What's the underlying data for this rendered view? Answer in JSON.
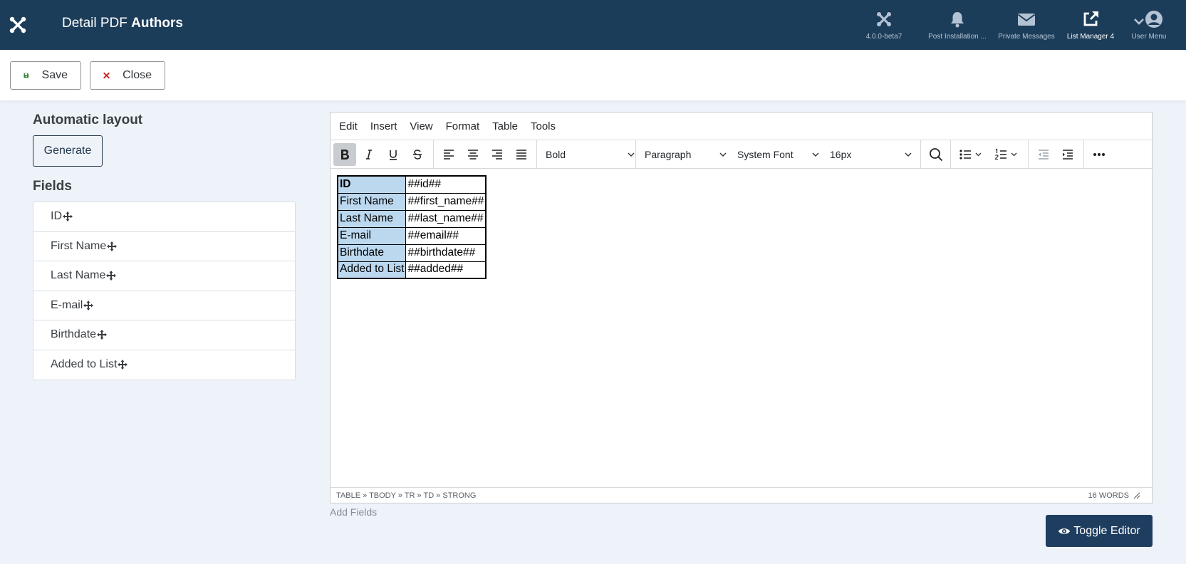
{
  "header": {
    "title_prefix": "Detail PDF",
    "title_strong": "Authors",
    "items": [
      {
        "label": "4.0.0-beta7",
        "icon": "joomla-icon"
      },
      {
        "label": "Post Installation ...",
        "icon": "bell-icon"
      },
      {
        "label": "Private Messages",
        "icon": "envelope-icon"
      },
      {
        "label": "List Manager 4",
        "icon": "external-link-icon"
      },
      {
        "label": "User Menu",
        "icon": "user-icon"
      }
    ]
  },
  "toolbar": {
    "save_label": "Save",
    "close_label": "Close"
  },
  "left": {
    "auto_layout_title": "Automatic layout",
    "generate_label": "Generate",
    "fields_title": "Fields",
    "fields": [
      "ID",
      "First Name",
      "Last Name",
      "E-mail",
      "Birthdate",
      "Added to List"
    ]
  },
  "editor": {
    "menu": [
      "Edit",
      "Insert",
      "View",
      "Format",
      "Table",
      "Tools"
    ],
    "block_format": "Bold",
    "paragraph_format": "Paragraph",
    "font_family": "System Font",
    "font_size": "16px",
    "table_rows": [
      {
        "label": "ID",
        "value": "##id##"
      },
      {
        "label": "First Name",
        "value": "##first_name##"
      },
      {
        "label": "Last Name",
        "value": "##last_name##"
      },
      {
        "label": "E-mail",
        "value": "##email##"
      },
      {
        "label": "Birthdate",
        "value": "##birthdate##"
      },
      {
        "label": "Added to List",
        "value": "##added##"
      }
    ],
    "path": "TABLE » TBODY » TR » TD » STRONG",
    "word_count": "16 WORDS"
  },
  "add_fields_label": "Add Fields",
  "toggle_editor_label": "Toggle Editor",
  "colors": {
    "header_bg": "#1c3d5a",
    "page_bg": "#eef3fa",
    "save_icon": "#2f7d32",
    "close_icon": "#c52827",
    "table_label_bg": "#bcd8ef",
    "toggle_bg": "#1f3d5f"
  }
}
